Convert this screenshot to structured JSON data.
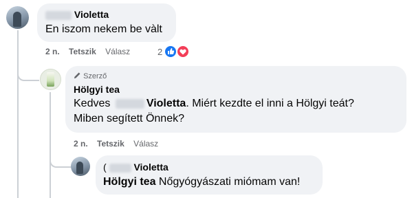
{
  "comments": [
    {
      "name": "Violetta",
      "text": "En iszom nekem be vàlt",
      "time": "2 n.",
      "like_label": "Tetszik",
      "reply_label": "Válasz",
      "reaction_count": "2",
      "reactions": [
        "like-icon",
        "love-icon"
      ]
    },
    {
      "author_badge": "Szerző",
      "name": "Hölgyi tea",
      "text_greeting": "Kedves",
      "text_mention": "Violetta",
      "text_line1_rest": ". Miért kezdte el inni a Hölgyi teát?",
      "text_line2": "Miben segített Önnek?",
      "time": "2 n.",
      "like_label": "Tetszik",
      "reply_label": "Válasz"
    },
    {
      "name_prefix": "(",
      "name": "Violetta",
      "mention": "Hölgyi tea",
      "text": " Nőgyógyászati miómam van!"
    }
  ],
  "colors": {
    "bubble": "#f0f2f5",
    "meta_text": "#65676b",
    "thread_line": "#ccd0d5",
    "like_blue": "#1877f2",
    "love_red": "#f33e58"
  }
}
